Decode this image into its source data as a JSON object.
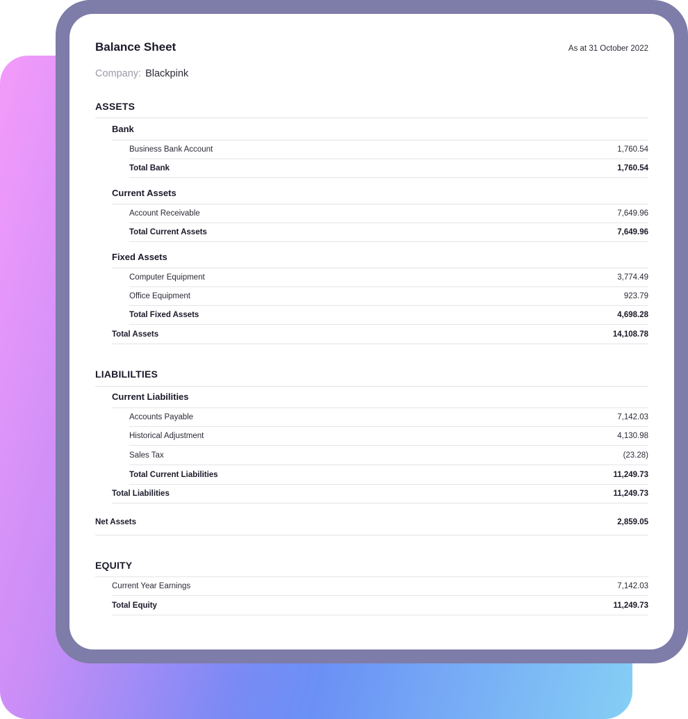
{
  "report": {
    "title": "Balance Sheet",
    "as_at": "As at 31 October 2022",
    "company_label": "Company:",
    "company_name": "Blackpink"
  },
  "assets": {
    "title": "ASSETS",
    "bank": {
      "title": "Bank",
      "rows": [
        {
          "label": "Business Bank Account",
          "amount": "1,760.54"
        }
      ],
      "total": {
        "label": "Total Bank",
        "amount": "1,760.54"
      }
    },
    "current": {
      "title": "Current Assets",
      "rows": [
        {
          "label": "Account Receivable",
          "amount": "7,649.96"
        }
      ],
      "total": {
        "label": "Total Current Assets",
        "amount": "7,649.96"
      }
    },
    "fixed": {
      "title": "Fixed Assets",
      "rows": [
        {
          "label": "Computer Equipment",
          "amount": "3,774.49"
        },
        {
          "label": "Office Equipment",
          "amount": "923.79"
        }
      ],
      "total": {
        "label": "Total Fixed Assets",
        "amount": "4,698.28"
      }
    },
    "total": {
      "label": "Total Assets",
      "amount": "14,108.78"
    }
  },
  "liabilities": {
    "title": "LIABILILTIES",
    "current": {
      "title": "Current Liabilities",
      "rows": [
        {
          "label": "Accounts Payable",
          "amount": "7,142.03"
        },
        {
          "label": "Historical Adjustment",
          "amount": "4,130.98"
        },
        {
          "label": "Sales Tax",
          "amount": "(23.28)"
        }
      ],
      "total": {
        "label": "Total Current Liabilities",
        "amount": "11,249.73"
      }
    },
    "total": {
      "label": "Total Liabilities",
      "amount": "11,249.73"
    }
  },
  "net_assets": {
    "label": "Net Assets",
    "amount": "2,859.05"
  },
  "equity": {
    "title": "EQUITY",
    "rows": [
      {
        "label": "Current Year Earnings",
        "amount": "7,142.03"
      }
    ],
    "total": {
      "label": "Total Equity",
      "amount": "11,249.73"
    }
  }
}
